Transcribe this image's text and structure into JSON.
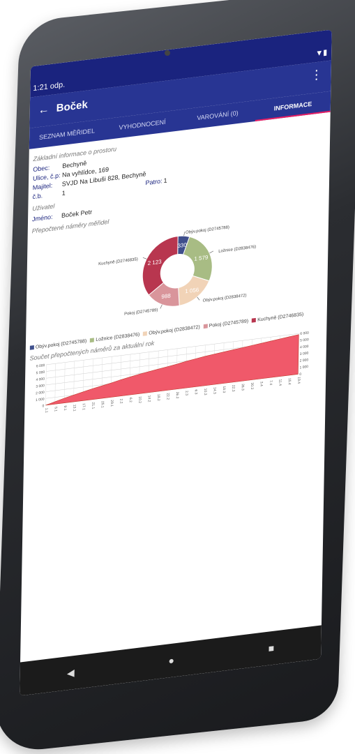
{
  "status": {
    "time": "1:21 odp.",
    "icons": "▼▮"
  },
  "toolbar": {
    "title": "Boček",
    "back_icon": "←",
    "more_icon": "⋮"
  },
  "tabs": [
    {
      "label": "SEZNAM MĚŘIDEL",
      "active": false
    },
    {
      "label": "VYHODNOCENÍ",
      "active": false
    },
    {
      "label": "VAROVÁNÍ (0)",
      "active": false
    },
    {
      "label": "INFORMACE",
      "active": true
    }
  ],
  "info": {
    "section_title": "Základní informace o prostoru",
    "rows": [
      {
        "label": "Obec:",
        "value": "Bechyně"
      },
      {
        "label": "Ulice, č.p:",
        "value": "Na vyhlídce, 169"
      },
      {
        "label": "Majitel:",
        "value": "SVJD Na Libuši 828, Bechyně"
      },
      {
        "label": "č.b.",
        "value": "1"
      }
    ],
    "patro_label": "Patro:",
    "patro_value": "1"
  },
  "user": {
    "section_title": "Uživatel",
    "name_label": "Jméno:",
    "name_value": "Boček Petr"
  },
  "donut_title": "Přepočtené náměry měřidel",
  "sum_title": "Součet přepočtených náměrů za aktuální rok",
  "chart_data": [
    {
      "type": "pie",
      "donut": true,
      "title": "Přepočtené náměry měřidel",
      "slices": [
        {
          "label": "Obýv.pokoj (D2745788)",
          "value": 330,
          "color": "#3f4f8c"
        },
        {
          "label": "Ložnice (D2838476)",
          "value": 1579,
          "color": "#a8bc84"
        },
        {
          "label": "Obýv.pokoj (D2838472)",
          "value": 1056,
          "color": "#f1d3b7"
        },
        {
          "label": "Pokoj (D2745789)",
          "value": 988,
          "color": "#d9959b"
        },
        {
          "label": "Kuchyně (D2746835)",
          "value": 2123,
          "color": "#b8364f"
        }
      ],
      "legend": "bottom",
      "data_labels": [
        "330",
        "1 579",
        "1 056",
        "988",
        "2 123"
      ]
    },
    {
      "type": "area",
      "title": "Součet přepočtených náměrů za aktuální rok",
      "x": [
        "1.1",
        "5.1",
        "9.1",
        "13.1",
        "17.1",
        "21.1",
        "25.1",
        "29.1",
        "2.2",
        "6.2",
        "10.2",
        "14.2",
        "18.2",
        "22.2",
        "26.2",
        "2.3",
        "6.3",
        "10.3",
        "14.3",
        "18.3",
        "22.3",
        "26.3",
        "30.3",
        "3.4",
        "7.4",
        "11.4",
        "15.4",
        "19.4"
      ],
      "values": [
        0,
        350,
        700,
        1000,
        1300,
        1600,
        1850,
        2100,
        2400,
        2650,
        2900,
        3100,
        3300,
        3500,
        3700,
        3950,
        4150,
        4350,
        4500,
        4650,
        4800,
        4950,
        5100,
        5250,
        5400,
        5550,
        5700,
        5850
      ],
      "ylim": [
        0,
        6000
      ],
      "yticks_left": [
        "6 000",
        "5 000",
        "4 000",
        "3 000",
        "2 000",
        "1 000",
        "0"
      ],
      "yticks_right": [
        "6 000",
        "5 000",
        "4 000",
        "3 000",
        "2 000",
        "1 000",
        "0"
      ],
      "color": "#f0596a",
      "grid": true
    }
  ],
  "navbar": {
    "back": "◀",
    "home": "●",
    "recent": "■"
  }
}
